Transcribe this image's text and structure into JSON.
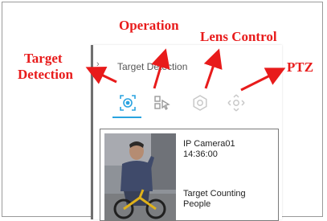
{
  "panel": {
    "title": "Target Detection",
    "chevron": "›"
  },
  "toolbar": {
    "buttons": [
      {
        "icon": "target-detection-icon",
        "active": true,
        "color": "#29a3e0"
      },
      {
        "icon": "operation-icon",
        "active": false,
        "color": "#9a9a9a"
      },
      {
        "icon": "lens-control-icon",
        "active": false,
        "color": "#c8c8c8"
      },
      {
        "icon": "ptz-icon",
        "active": false,
        "color": "#c8c8c8"
      }
    ]
  },
  "event_card": {
    "camera": "IP Camera01",
    "time": "14:36:00",
    "type_line1": "Target Counting",
    "type_line2": "People"
  },
  "callouts": {
    "target_detection_line1": "Target",
    "target_detection_line2": "Detection",
    "operation": "Operation",
    "lens_control": "Lens Control",
    "ptz": "PTZ",
    "color": "#e81b1b"
  }
}
